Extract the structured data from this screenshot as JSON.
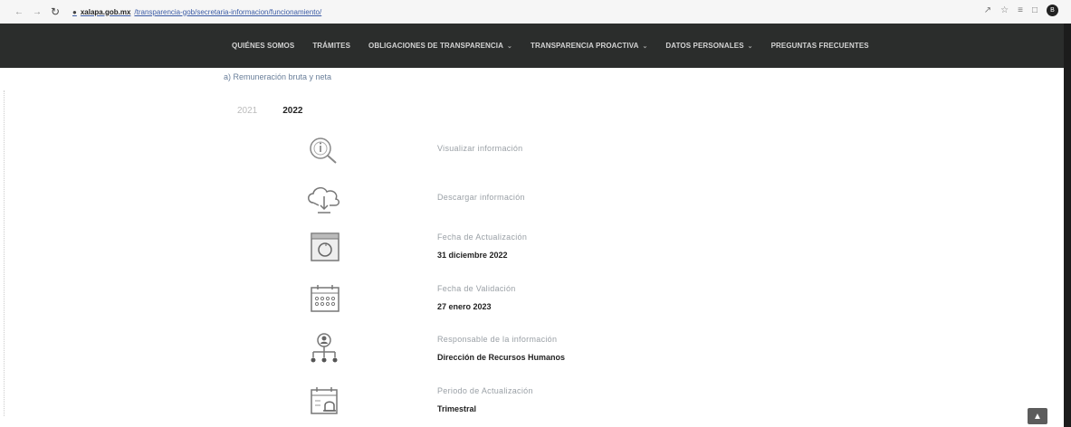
{
  "browser": {
    "back_icon": "arrow-left-icon",
    "forward_icon": "arrow-right-icon",
    "reload_icon": "reload-icon",
    "url_host": "xalapa.gob.mx",
    "url_path": "/transparencia-gob/secretaria-informacion/funcionamiento/"
  },
  "navbar": {
    "items": [
      {
        "label": "QUIÉNES SOMOS"
      },
      {
        "label": "TRÁMITES"
      },
      {
        "label": "OBLIGACIONES DE TRANSPARENCIA"
      },
      {
        "label": "TRANSPARENCIA PROACTIVA"
      },
      {
        "label": "DATOS PERSONALES"
      },
      {
        "label": "PREGUNTAS FRECUENTES"
      }
    ]
  },
  "section": {
    "title": "a) Remuneración bruta y neta"
  },
  "years": {
    "y2021": "2021",
    "y2022": "2022"
  },
  "actions": {
    "visualize": "Visualizar información",
    "download": "Descargar información"
  },
  "details": {
    "update_label": "Fecha de Actualización",
    "update_value": "31 diciembre 2022",
    "validation_label": "Fecha de Validación",
    "validation_value": "27 enero 2023",
    "responsible_label": "Responsable de la información",
    "responsible_value": "Dirección de Recursos Humanos",
    "period_label": "Periodo de Actualización",
    "period_value": "Trimestral"
  },
  "colors": {
    "navbar_bg": "#2b2d2c",
    "icon_gray": "#888888"
  }
}
